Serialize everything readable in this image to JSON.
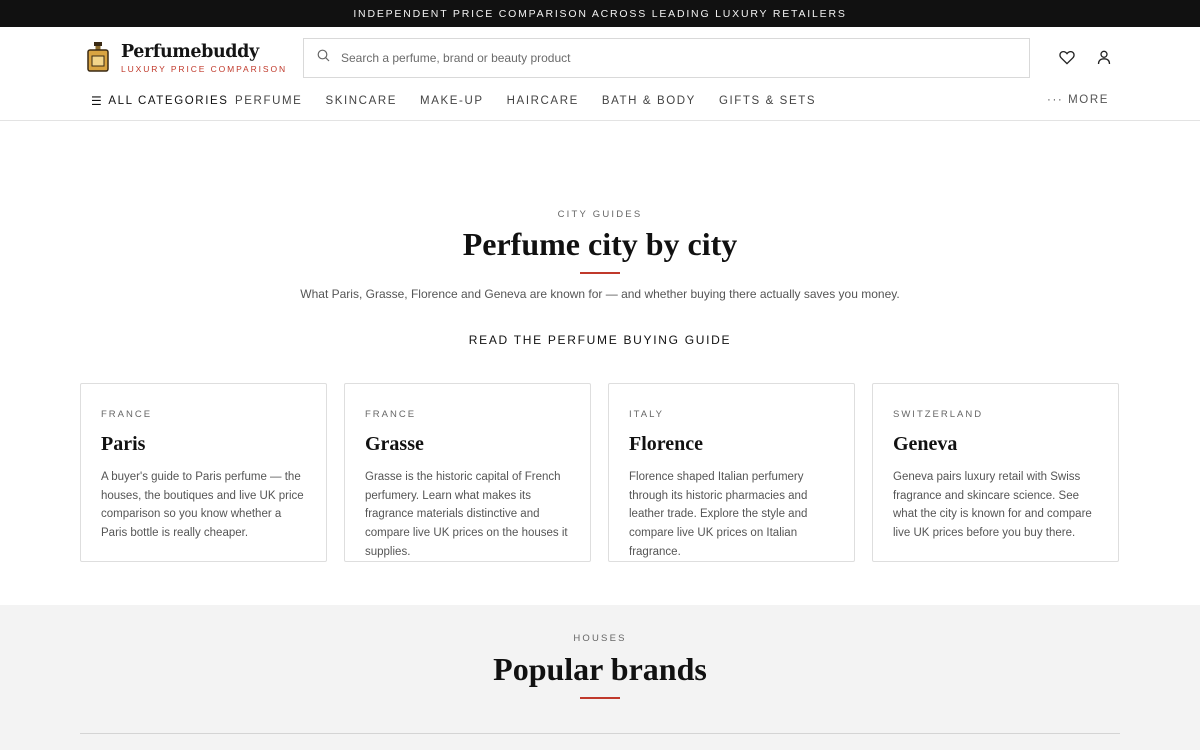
{
  "announcement": "INDEPENDENT PRICE COMPARISON ACROSS LEADING LUXURY RETAILERS",
  "brand": {
    "name": "Perfumebuddy",
    "tagline": "LUXURY PRICE COMPARISON",
    "logo_icon": "perfume-bottle-icon"
  },
  "search": {
    "placeholder": "Search a perfume, brand or beauty product",
    "icon": "search-icon"
  },
  "header_icons": [
    "heart-icon",
    "user-icon"
  ],
  "nav": {
    "all_label": "ALL CATEGORIES",
    "items": [
      "PERFUME",
      "SKINCARE",
      "MAKE-UP",
      "HAIRCARE",
      "BATH & BODY",
      "GIFTS & SETS"
    ],
    "more_label": "··· MORE"
  },
  "city_section": {
    "eyebrow": "CITY GUIDES",
    "title": "Perfume city by city",
    "lede": "What Paris, Grasse, Florence and Geneva are known for — and whether buying there actually saves you money.",
    "link": "READ THE PERFUME BUYING GUIDE",
    "cards": [
      {
        "country": "FRANCE",
        "city": "Paris",
        "desc": "A buyer's guide to Paris perfume — the houses, the boutiques and live UK price comparison so you know whether a Paris bottle is really cheaper."
      },
      {
        "country": "FRANCE",
        "city": "Grasse",
        "desc": "Grasse is the historic capital of French perfumery. Learn what makes its fragrance materials distinctive and compare live UK prices on the houses it supplies."
      },
      {
        "country": "ITALY",
        "city": "Florence",
        "desc": "Florence shaped Italian perfumery through its historic pharmacies and leather trade. Explore the style and compare live UK prices on Italian fragrance."
      },
      {
        "country": "SWITZERLAND",
        "city": "Geneva",
        "desc": "Geneva pairs luxury retail with Swiss fragrance and skincare science. See what the city is known for and compare live UK prices before you buy there."
      }
    ]
  },
  "brands_section": {
    "eyebrow": "HOUSES",
    "title": "Popular brands"
  },
  "colors": {
    "accent": "#c0392b",
    "topbar": "#111111",
    "brands_bg": "#f3f3f3"
  }
}
